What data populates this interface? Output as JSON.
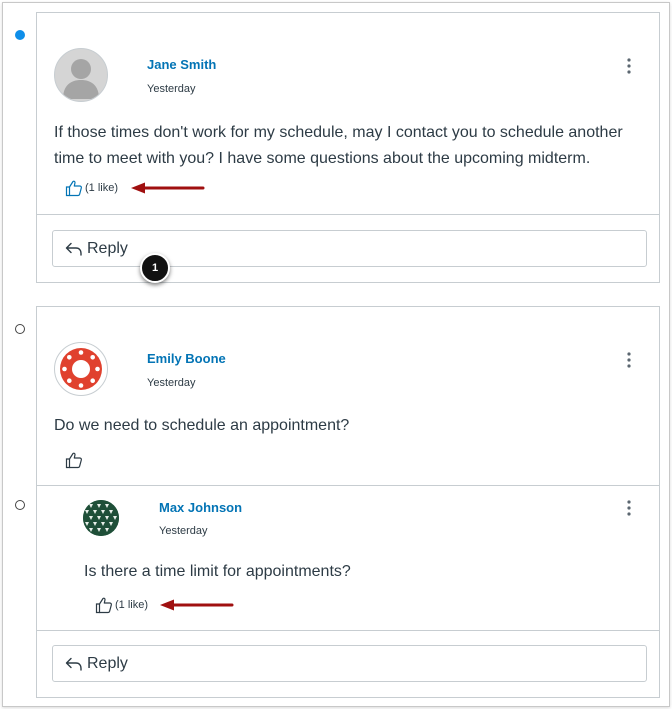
{
  "posts": [
    {
      "author": "Jane Smith",
      "date": "Yesterday",
      "message": "If those times don't work for my schedule, may I contact you to schedule another time to meet with you? I have some questions about the upcoming midterm.",
      "likes": "(1 like)",
      "liked": true,
      "read": false,
      "avatar": "default-avatar"
    },
    {
      "author": "Emily Boone",
      "date": "Yesterday",
      "message": "Do we need to schedule an appointment?",
      "likes": "",
      "liked": false,
      "read": true,
      "avatar": "canvas-logo-avatar"
    }
  ],
  "nested_reply": {
    "author": "Max Johnson",
    "date": "Yesterday",
    "message": "Is there a time limit for appointments?",
    "likes": "(1 like)",
    "read": true,
    "avatar": "pattern-avatar"
  },
  "reply_label": "Reply",
  "callout_number": "1",
  "colors": {
    "accent": "#0374b5",
    "unread_dot": "#0e8ee9",
    "annotation_arrow": "#a01010",
    "callout": "#111111"
  }
}
